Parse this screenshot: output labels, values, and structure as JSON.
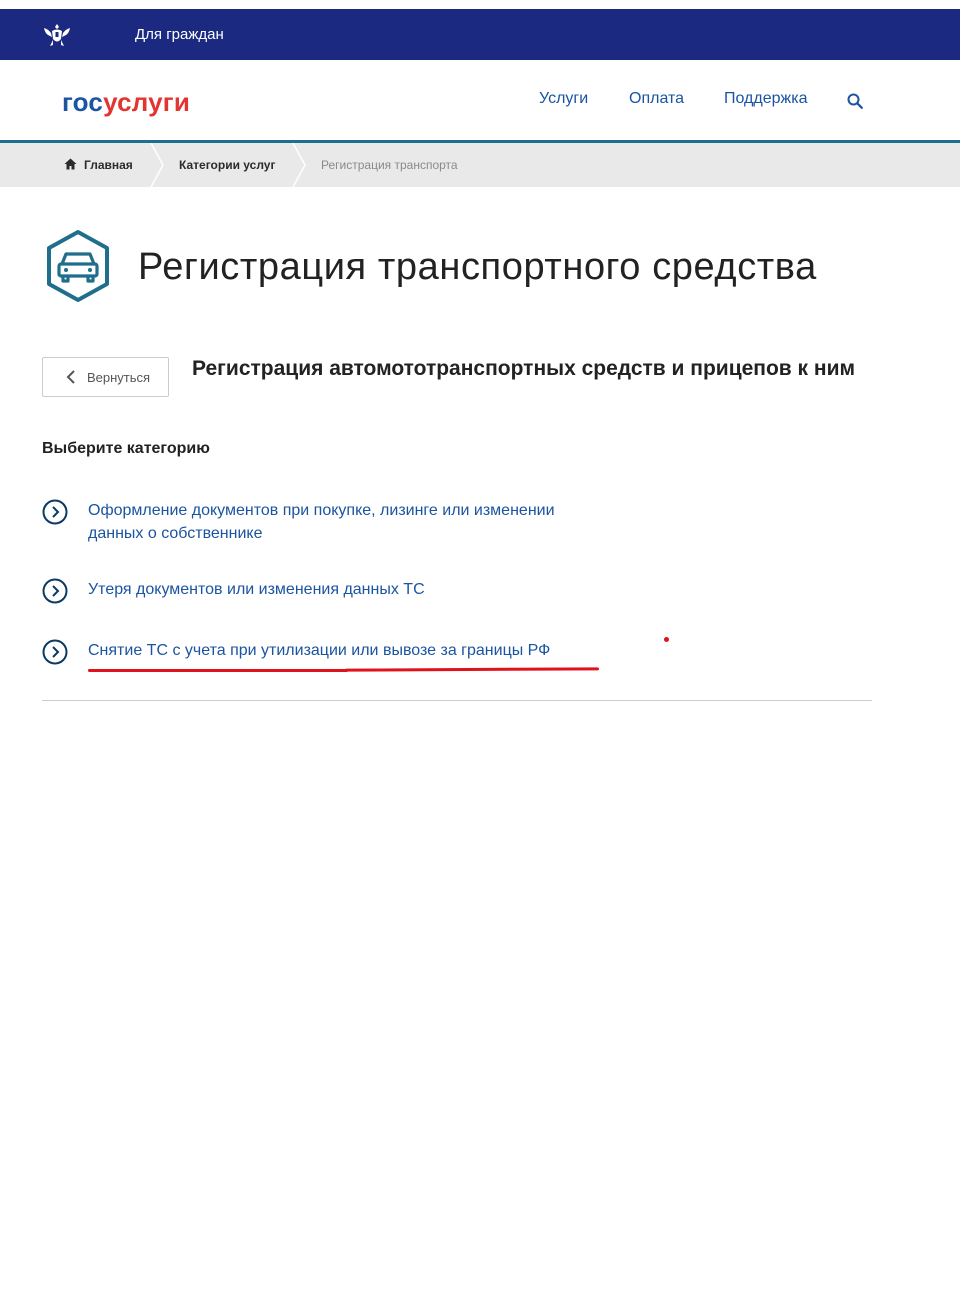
{
  "topbar": {
    "citizens_label": "Для граждан",
    "bg_color": "#1b2a80"
  },
  "header": {
    "logo_part1": "гос",
    "logo_part2": "услуги",
    "nav": [
      "Услуги",
      "Оплата",
      "Поддержка"
    ],
    "brand_blue": "#1b54a0",
    "brand_red": "#e3342f"
  },
  "breadcrumbs": {
    "items": [
      "Главная",
      "Категории услуг",
      "Регистрация транспорта"
    ]
  },
  "page": {
    "title": "Регистрация транспортного средства",
    "back_label": "Вернуться",
    "subtitle": "Регистрация автомототранспортных средств и прицепов к ним",
    "choose_label": "Выберите категорию"
  },
  "categories": [
    {
      "label": "Оформление документов при покупке, лизинге или изменении данных о собственнике",
      "icon": "chevron-circle-icon"
    },
    {
      "label": "Утеря документов или изменения данных ТС",
      "icon": "chevron-circle-icon"
    },
    {
      "label": "Снятие ТС с учета при утилизации или вывозе за границы РФ",
      "icon": "chevron-circle-icon",
      "highlighted": true
    }
  ],
  "annotation_color": "#e0121b"
}
